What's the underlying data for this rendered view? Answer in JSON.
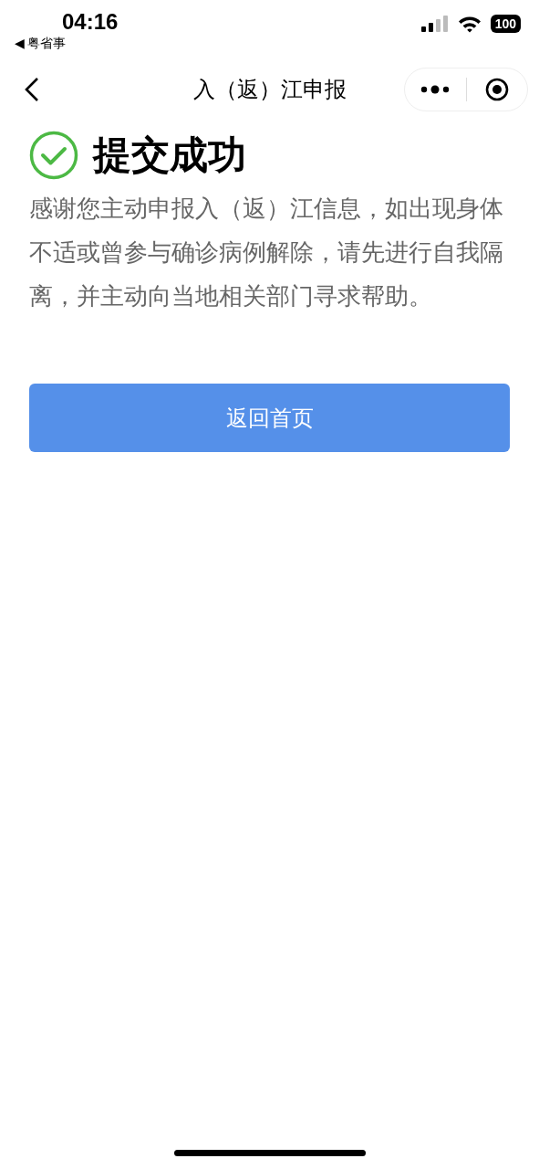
{
  "status_bar": {
    "time": "04:16",
    "back_arrow": "◀",
    "back_app": "粤省事",
    "battery": "100"
  },
  "nav_bar": {
    "title": "入（返）江申报"
  },
  "result": {
    "title": "提交成功",
    "message": "感谢您主动申报入（返）江信息，如出现身体不适或曾参与确诊病例解除，请先进行自我隔离，并主动向当地相关部门寻求帮助。"
  },
  "button": {
    "label": "返回首页"
  }
}
